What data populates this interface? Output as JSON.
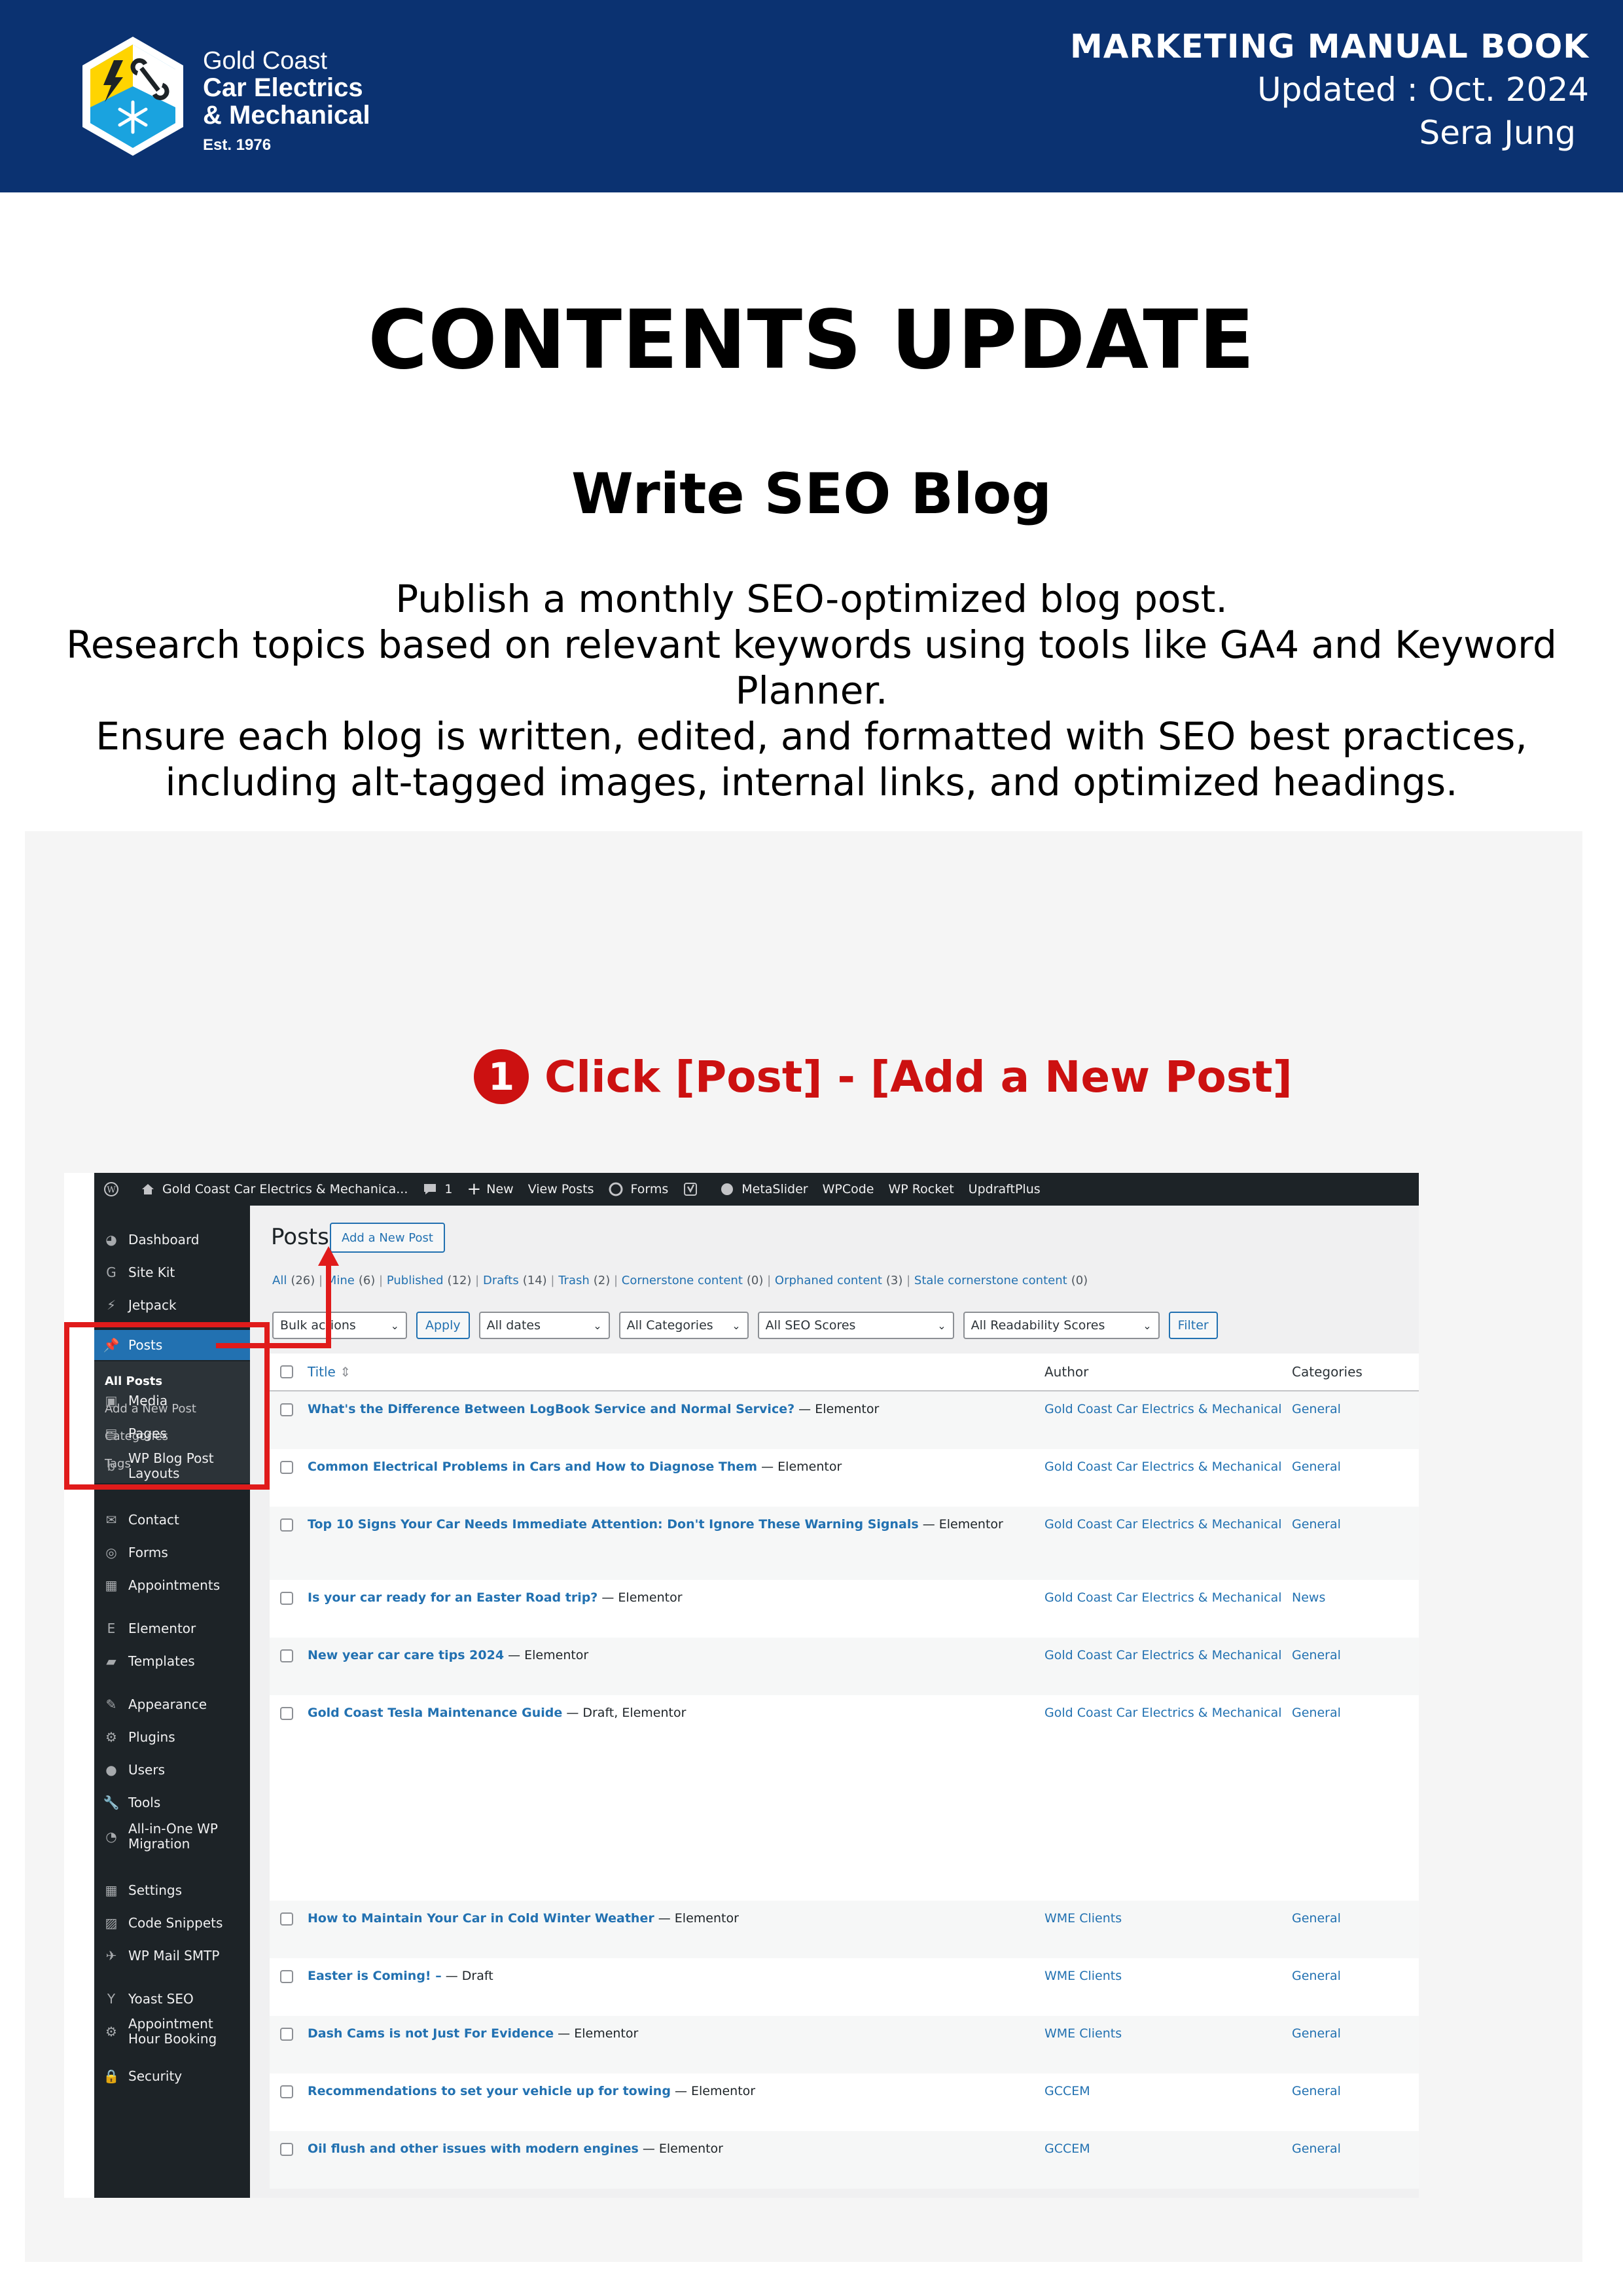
{
  "header": {
    "brand_line1": "Gold Coast",
    "brand_line2": "Car Electrics",
    "brand_line3": "& Mechanical",
    "brand_est": "Est. 1976",
    "doc_title": "MARKETING MANUAL BOOK",
    "updated": "Updated : Oct. 2024",
    "author": "Sera Jung"
  },
  "main_title": "CONTENTS UPDATE",
  "section_title": "Write SEO Blog",
  "intro": [
    "Publish a monthly SEO-optimized blog post.",
    "Research topics based on relevant keywords using tools like GA4 and Keyword Planner.",
    "Ensure each blog is written, edited, and formatted with SEO best practices,",
    "including alt-tagged images, internal links, and optimized headings."
  ],
  "step": {
    "number": "1",
    "text": "Click [Post] - [Add a New Post]"
  },
  "colors": {
    "header_bg": "#0b3271",
    "accent_red": "#cc1111",
    "wp_blue": "#2271b1",
    "wp_dark": "#1d2327"
  },
  "adminbar": {
    "site": "Gold Coast Car Electrics & Mechanica...",
    "comments": "1",
    "new": "New",
    "view_posts": "View Posts",
    "forms": "Forms",
    "metaslider": "MetaSlider",
    "wpcode": "WPCode",
    "wprocket": "WP Rocket",
    "updraft": "UpdraftPlus"
  },
  "sidebar": {
    "items": [
      {
        "label": "Dashboard",
        "icon": "dashboard-icon"
      },
      {
        "label": "Site Kit",
        "icon": "google-icon"
      },
      {
        "label": "Jetpack",
        "icon": "jetpack-icon"
      },
      {
        "label": "Posts",
        "icon": "pin-icon"
      },
      {
        "label": "Media",
        "icon": "media-icon"
      },
      {
        "label": "Pages",
        "icon": "pages-icon"
      },
      {
        "label": "WP Blog Post\nLayouts",
        "icon": "blog-layout-icon"
      },
      {
        "label": "Contact",
        "icon": "mail-icon"
      },
      {
        "label": "Forms",
        "icon": "forms-icon"
      },
      {
        "label": "Appointments",
        "icon": "calendar-icon"
      },
      {
        "label": "Elementor",
        "icon": "elementor-icon"
      },
      {
        "label": "Templates",
        "icon": "folder-icon"
      },
      {
        "label": "Appearance",
        "icon": "brush-icon"
      },
      {
        "label": "Plugins",
        "icon": "plug-icon"
      },
      {
        "label": "Users",
        "icon": "user-icon"
      },
      {
        "label": "Tools",
        "icon": "wrench-icon"
      },
      {
        "label": "All-in-One WP\nMigration",
        "icon": "migration-icon"
      },
      {
        "label": "Settings",
        "icon": "settings-icon"
      },
      {
        "label": "Code Snippets",
        "icon": "code-icon"
      },
      {
        "label": "WP Mail SMTP",
        "icon": "send-icon"
      },
      {
        "label": "Yoast SEO",
        "icon": "yoast-icon"
      },
      {
        "label": "Appointment\nHour Booking",
        "icon": "gear-icon"
      },
      {
        "label": "Security",
        "icon": "lock-icon"
      }
    ],
    "submenu": [
      "All Posts",
      "Add a New Post",
      "Categories",
      "Tags"
    ]
  },
  "posts": {
    "heading": "Posts",
    "add_new": "Add a New Post",
    "filters": [
      {
        "label": "All",
        "count": "(26)"
      },
      {
        "label": "Mine",
        "count": "(6)"
      },
      {
        "label": "Published",
        "count": "(12)"
      },
      {
        "label": "Drafts",
        "count": "(14)"
      },
      {
        "label": "Trash",
        "count": "(2)"
      },
      {
        "label": "Cornerstone content",
        "count": "(0)"
      },
      {
        "label": "Orphaned content",
        "count": "(3)"
      },
      {
        "label": "Stale cornerstone content",
        "count": "(0)"
      }
    ],
    "bulk_actions": "Bulk actions",
    "apply": "Apply",
    "all_dates": "All dates",
    "all_categories": "All Categories",
    "all_seo": "All SEO Scores",
    "all_readability": "All Readability Scores",
    "filter": "Filter",
    "col_title": "Title",
    "col_author": "Author",
    "col_categories": "Categories",
    "rows": [
      {
        "title": "What's the Difference Between LogBook Service and Normal Service?",
        "suffix": " — Elementor",
        "author": "Gold Coast Car Electrics & Mechanical",
        "category": "General"
      },
      {
        "title": "Common Electrical Problems in Cars and How to Diagnose Them",
        "suffix": " — Elementor",
        "author": "Gold Coast Car Electrics & Mechanical",
        "category": "General"
      },
      {
        "title": "Top 10 Signs Your Car Needs Immediate Attention: Don't Ignore These Warning Signals",
        "suffix": " — Elementor",
        "author": "Gold Coast Car Electrics & Mechanical",
        "category": "General"
      },
      {
        "title": "Is your car ready for an Easter Road trip?",
        "suffix": " — Elementor",
        "author": "Gold Coast Car Electrics & Mechanical",
        "category": "News"
      },
      {
        "title": "New year car care tips 2024",
        "suffix": " — Elementor",
        "author": "Gold Coast Car Electrics & Mechanical",
        "category": "General"
      },
      {
        "title": "Gold Coast Tesla Maintenance Guide",
        "suffix": " — Draft, Elementor",
        "author": "Gold Coast Car Electrics & Mechanical",
        "category": "General"
      },
      {
        "title": "How to Maintain Your Car in Cold Winter Weather",
        "suffix": " — Elementor",
        "author": "WME Clients",
        "category": "General"
      },
      {
        "title": "Easter is Coming! –",
        "suffix": " — Draft",
        "author": "WME Clients",
        "category": "General"
      },
      {
        "title": "Dash Cams is not Just For Evidence",
        "suffix": " — Elementor",
        "author": "WME Clients",
        "category": "General"
      },
      {
        "title": "Recommendations to set your vehicle up for towing",
        "suffix": " — Elementor",
        "author": "GCCEM",
        "category": "General"
      },
      {
        "title": "Oil flush and other issues with modern engines",
        "suffix": " — Elementor",
        "author": "GCCEM",
        "category": "General"
      }
    ]
  }
}
